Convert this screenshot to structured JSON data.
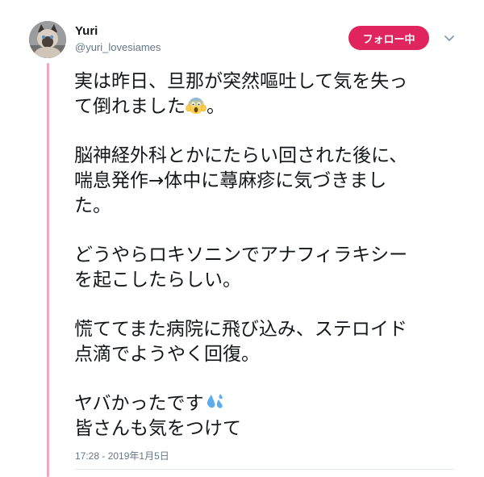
{
  "user": {
    "name": "Yuri",
    "handle": "@yuri_lovesiames"
  },
  "follow_button": {
    "label": "フォロー中"
  },
  "tweet": {
    "p1": {
      "l1": "実は昨日、旦那が突然嘔吐して気を失っ",
      "l2a": "て倒れました",
      "l2_emoji": "face-screaming-in-fear",
      "l2b": "。"
    },
    "p2": {
      "l1": "脳神経外科とかにたらい回された後に、",
      "l2": "喘息発作→体中に蕁麻疹に気づきまし",
      "l3": "た。"
    },
    "p3": {
      "l1": "どうやらロキソニンでアナフィラキシー",
      "l2": "を起こしたらしい。"
    },
    "p4": {
      "l1": "慌ててまた病院に飛び込み、ステロイド",
      "l2": "点滴でようやく回復。"
    },
    "p5": {
      "l1": "ヤバかったです",
      "l1_emoji": "sweat-droplets",
      "l2": "皆さんも気をつけて"
    }
  },
  "timestamp": "17:28 - 2019年1月5日",
  "colors": {
    "accent": "#e0245e",
    "thread_line": "#f4a5bf",
    "secondary_text": "#657786"
  }
}
